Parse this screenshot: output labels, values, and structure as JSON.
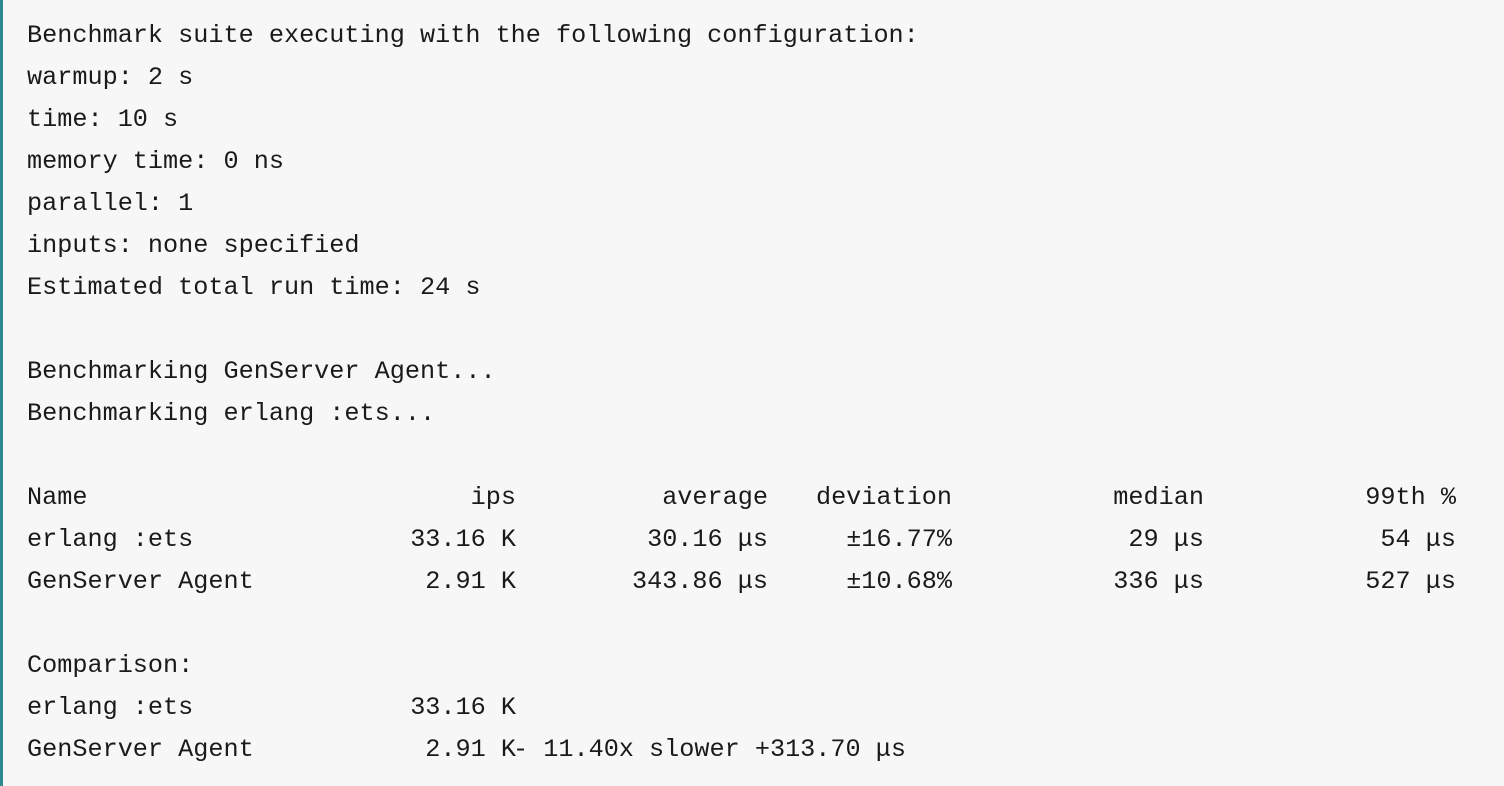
{
  "config": {
    "header": "Benchmark suite executing with the following configuration:",
    "warmup": "warmup: 2 s",
    "time": "time: 10 s",
    "memory_time": "memory time: 0 ns",
    "parallel": "parallel: 1",
    "inputs": "inputs: none specified",
    "estimated": "Estimated total run time: 24 s"
  },
  "progress": [
    "Benchmarking GenServer Agent...",
    "Benchmarking erlang :ets..."
  ],
  "table": {
    "headers": [
      "Name",
      "ips",
      "average",
      "deviation",
      "median",
      "99th %"
    ],
    "rows": [
      [
        "erlang :ets",
        "33.16 K",
        "30.16 μs",
        "±16.77%",
        "29 μs",
        "54 μs"
      ],
      [
        "GenServer Agent",
        "2.91 K",
        "343.86 μs",
        "±10.68%",
        "336 μs",
        "527 μs"
      ]
    ]
  },
  "comparison": {
    "title": "Comparison:",
    "rows": [
      {
        "name": "erlang :ets",
        "ips": "33.16 K",
        "rest": ""
      },
      {
        "name": "GenServer Agent",
        "ips": "2.91 K",
        "rest": "- 11.40x slower +313.70 μs"
      }
    ]
  }
}
